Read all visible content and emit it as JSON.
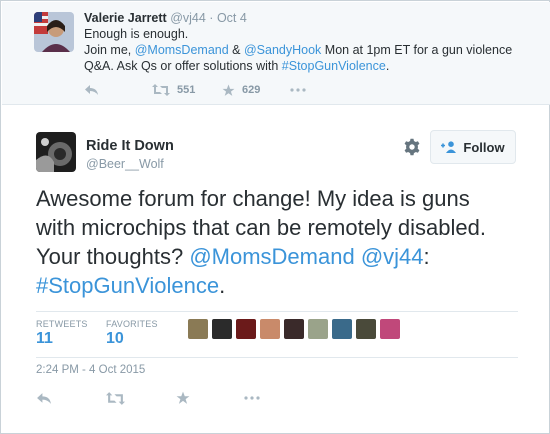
{
  "parent_tweet": {
    "name": "Valerie Jarrett",
    "handle": "@vj44",
    "separator": "·",
    "date": "Oct 4",
    "line1": "Enough is enough.",
    "text_join": "Join me, ",
    "mention1": "@MomsDemand",
    "amp": " & ",
    "mention2": "@SandyHook",
    "text_mid": " Mon at 1pm ET for a gun violence Q&A. Ask Qs or offer solutions with ",
    "hashtag": "#StopGunViolence",
    "text_end": ".",
    "retweet_count": "551",
    "favorite_count": "629",
    "icons": [
      "reply-icon",
      "retweet-icon",
      "star-icon",
      "more-icon"
    ]
  },
  "main_tweet": {
    "name": "Ride It Down",
    "handle": "@Beer__Wolf",
    "follow_label": "Follow",
    "text_main": "Awesome forum for change! My idea is guns with microchips that can be remotely disabled. Your thoughts? ",
    "mention1": "@MomsDemand",
    "space": " ",
    "mention2": "@vj44",
    "colon": ": ",
    "hashtag": "#StopGunViolence",
    "text_end": ".",
    "retweets_label": "RETWEETS",
    "retweets_value": "11",
    "favorites_label": "FAVORITES",
    "favorites_value": "10",
    "timestamp": "2:24 PM - 4 Oct 2015",
    "favoriter_avatar_colors": [
      "#8a7a55",
      "#2b2b2b",
      "#6b1a1a",
      "#c98a6a",
      "#3a2a2a",
      "#9aa38a",
      "#3a6a8a",
      "#4a4a3a",
      "#c0487a"
    ],
    "icons": [
      "reply-icon",
      "retweet-icon",
      "star-icon",
      "more-icon",
      "gear-icon",
      "follow-person-icon"
    ]
  },
  "colors": {
    "link": "#3b94d9",
    "muted": "#8899a6",
    "text": "#292f33",
    "parent_bg": "#f5f8fa"
  }
}
